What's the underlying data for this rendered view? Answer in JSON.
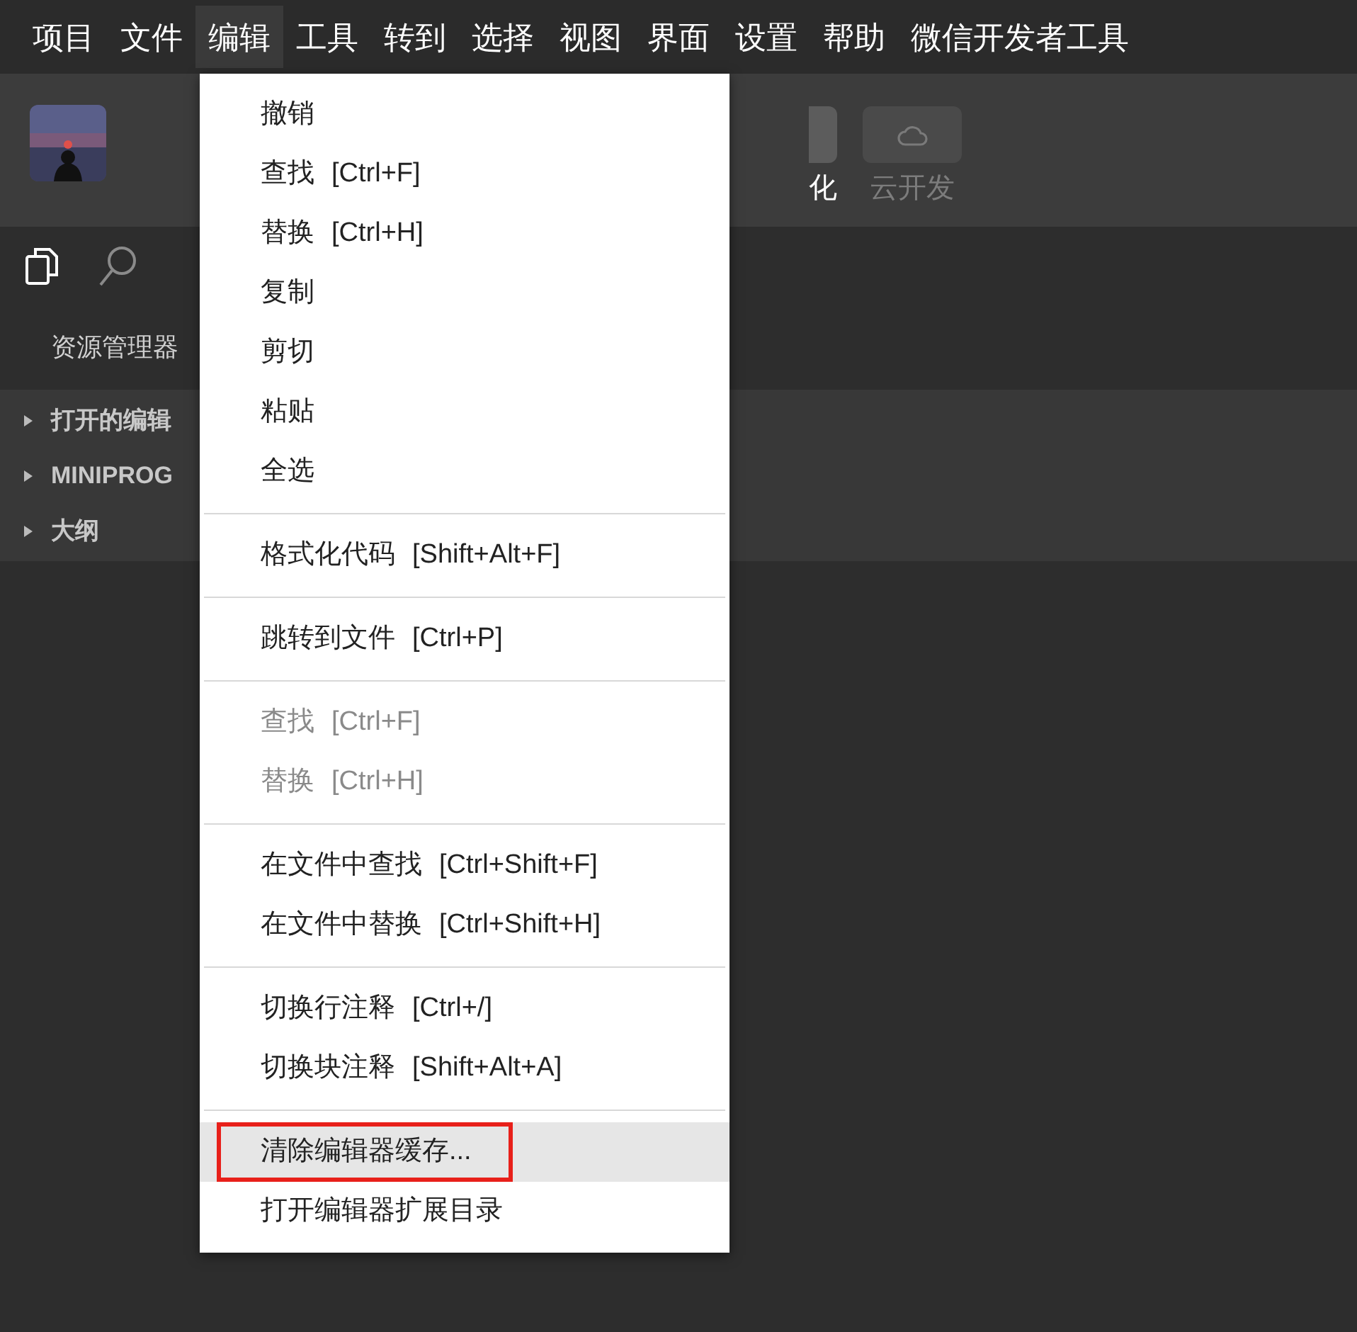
{
  "menubar": [
    {
      "label": "项目",
      "selected": false
    },
    {
      "label": "文件",
      "selected": false
    },
    {
      "label": "编辑",
      "selected": true
    },
    {
      "label": "工具",
      "selected": false
    },
    {
      "label": "转到",
      "selected": false
    },
    {
      "label": "选择",
      "selected": false
    },
    {
      "label": "视图",
      "selected": false
    },
    {
      "label": "界面",
      "selected": false
    },
    {
      "label": "设置",
      "selected": false
    },
    {
      "label": "帮助",
      "selected": false
    },
    {
      "label": "微信开发者工具",
      "selected": false
    }
  ],
  "toolbar": {
    "partial_label": "化",
    "cloud_label": "云开发"
  },
  "sidebar": {
    "title": "资源管理器",
    "sections": [
      {
        "label": "打开的编辑",
        "expanded": false
      },
      {
        "label": "MINIPROG",
        "expanded": false
      },
      {
        "label": "大纲",
        "expanded": false
      }
    ]
  },
  "menu": [
    {
      "kind": "item",
      "label": "撤销",
      "disabled": false,
      "selected": false,
      "outlined": false
    },
    {
      "kind": "item",
      "label": "查找",
      "shortcut": "[Ctrl+F]",
      "disabled": false,
      "selected": false,
      "outlined": false
    },
    {
      "kind": "item",
      "label": "替换",
      "shortcut": "[Ctrl+H]",
      "disabled": false,
      "selected": false,
      "outlined": false
    },
    {
      "kind": "item",
      "label": "复制",
      "disabled": false,
      "selected": false,
      "outlined": false
    },
    {
      "kind": "item",
      "label": "剪切",
      "disabled": false,
      "selected": false,
      "outlined": false
    },
    {
      "kind": "item",
      "label": "粘贴",
      "disabled": false,
      "selected": false,
      "outlined": false
    },
    {
      "kind": "item",
      "label": "全选",
      "disabled": false,
      "selected": false,
      "outlined": false
    },
    {
      "kind": "separator"
    },
    {
      "kind": "item",
      "label": "格式化代码",
      "shortcut": "[Shift+Alt+F]",
      "disabled": false,
      "selected": false,
      "outlined": false
    },
    {
      "kind": "separator"
    },
    {
      "kind": "item",
      "label": "跳转到文件",
      "shortcut": "[Ctrl+P]",
      "disabled": false,
      "selected": false,
      "outlined": false
    },
    {
      "kind": "separator"
    },
    {
      "kind": "item",
      "label": "查找",
      "shortcut": "[Ctrl+F]",
      "disabled": true,
      "selected": false,
      "outlined": false
    },
    {
      "kind": "item",
      "label": "替换",
      "shortcut": "[Ctrl+H]",
      "disabled": true,
      "selected": false,
      "outlined": false
    },
    {
      "kind": "separator"
    },
    {
      "kind": "item",
      "label": "在文件中查找",
      "shortcut": "[Ctrl+Shift+F]",
      "disabled": false,
      "selected": false,
      "outlined": false
    },
    {
      "kind": "item",
      "label": "在文件中替换",
      "shortcut": "[Ctrl+Shift+H]",
      "disabled": false,
      "selected": false,
      "outlined": false
    },
    {
      "kind": "separator"
    },
    {
      "kind": "item",
      "label": "切换行注释",
      "shortcut": "[Ctrl+/]",
      "disabled": false,
      "selected": false,
      "outlined": false
    },
    {
      "kind": "item",
      "label": "切换块注释",
      "shortcut": "[Shift+Alt+A]",
      "disabled": false,
      "selected": false,
      "outlined": false
    },
    {
      "kind": "separator"
    },
    {
      "kind": "item",
      "label": "清除编辑器缓存...",
      "disabled": false,
      "selected": true,
      "outlined": true
    },
    {
      "kind": "item",
      "label": "打开编辑器扩展目录",
      "disabled": false,
      "selected": false,
      "outlined": false
    }
  ]
}
